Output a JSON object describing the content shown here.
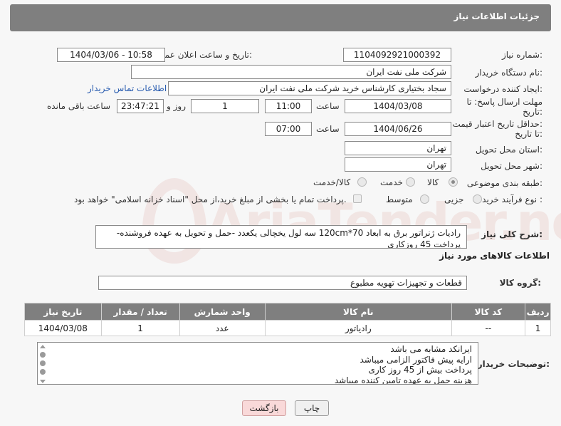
{
  "header": {
    "title": "جزئیات اطلاعات نیاز"
  },
  "fields": {
    "need_number_label": "شماره نیاز:",
    "need_number": "1104092921000392",
    "announce_label": "تاریخ و ساعت اعلان عمومی:",
    "announce_value": "1404/03/06 - 10:58",
    "buyer_org_label": "نام دستگاه خریدار:",
    "buyer_org": "شرکت ملی نفت ایران",
    "creator_label": "ایجاد کننده درخواست:",
    "creator": "سجاد بختیاری کارشناس خرید شرکت ملی نفت ایران",
    "contact_link": "اطلاعات تماس خریدار",
    "deadline_label_1": "مهلت ارسال پاسخ: تا",
    "deadline_label_2": "تاریخ:",
    "deadline_date": "1404/03/08",
    "time_label": "ساعت",
    "deadline_time": "11:00",
    "days_value": "1",
    "days_label": "روز و",
    "remaining_time": "23:47:21",
    "remaining_label": "ساعت باقی مانده",
    "validity_label_1": "حداقل تاریخ اعتبار قیمت:",
    "validity_label_2": "تا تاریخ:",
    "validity_date": "1404/06/26",
    "validity_time": "07:00",
    "province_label": "استان محل تحویل:",
    "province": "تهران",
    "city_label": "شهر محل تحویل:",
    "city": "تهران",
    "category_label": "طبقه بندی موضوعی:",
    "category_options": [
      "کالا",
      "خدمت",
      "کالا/خدمت"
    ],
    "process_label": "نوع فرآیند خرید :",
    "process_options": [
      "جزیی",
      "متوسط"
    ],
    "payment_note": "پرداخت تمام یا بخشی از مبلغ خرید،از محل \"اسناد خزانه اسلامی\" خواهد بود.",
    "general_desc_label": "شرح کلی نیاز:",
    "general_desc": "رادیات ژنراتور برق به ابعاد 70*120cm سه لول یخچالی یکعدد -حمل و تحویل به عهده فروشنده-پرداخت 45 روزکاری"
  },
  "goods": {
    "section_title": "اطلاعات کالاهای مورد نیاز",
    "group_label": "گروه کالا:",
    "group_value": "قطعات و تجهیزات تهویه مطبوع",
    "table": {
      "headers": [
        "ردیف",
        "کد کالا",
        "نام کالا",
        "واحد شمارش",
        "تعداد / مقدار",
        "تاریخ نیاز"
      ],
      "rows": [
        [
          "1",
          "--",
          "رادیاتور",
          "عدد",
          "1",
          "1404/03/08"
        ]
      ]
    }
  },
  "notes": {
    "label": "توضیحات خریدار:",
    "lines": [
      "ایرانکد مشابه می باشد",
      "ارایه پیش فاکتور الزامی میباشد",
      "پرداخت بیش از 45 روز کاری",
      "هزینه حمل به عهده تامین کننده میباشد"
    ]
  },
  "buttons": {
    "print": "چاپ",
    "back": "بازگشت"
  },
  "watermark": {
    "brand": "AriaTender.neT"
  }
}
